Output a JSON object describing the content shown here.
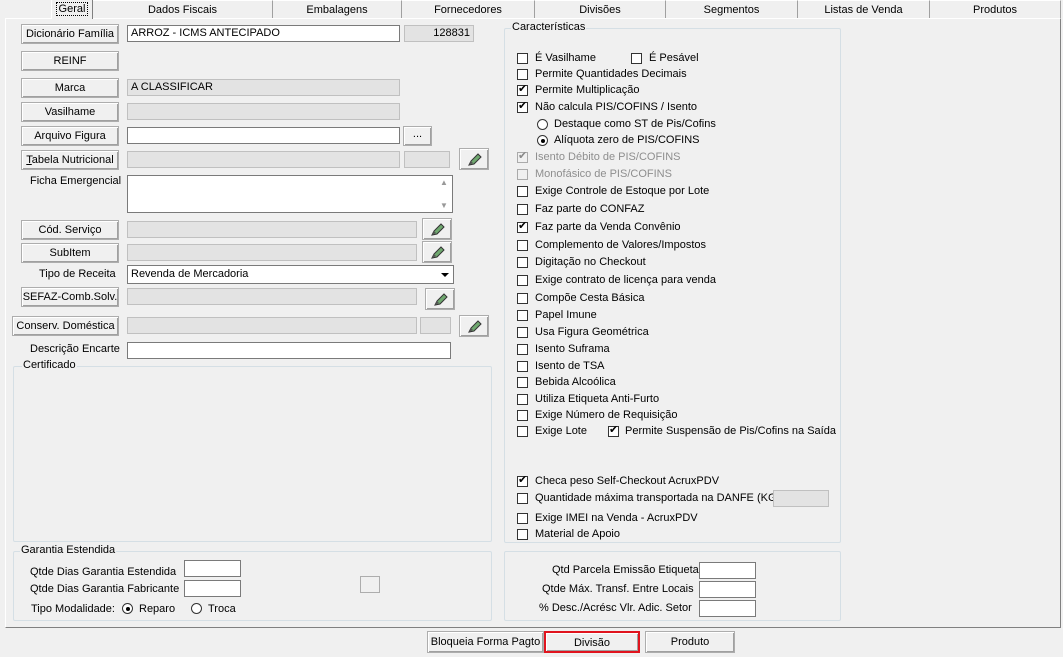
{
  "tabs": [
    "Geral",
    "Dados Fiscais",
    "Embalagens",
    "Fornecedores",
    "Divisões",
    "Segmentos",
    "Listas de Venda",
    "Produtos"
  ],
  "left": {
    "dicionario_label": "Dicionário Família",
    "dicionario_value": "ARROZ - ICMS ANTECIPADO",
    "dicionario_code": "128831",
    "reinf_label": "REINF",
    "marca_label": "Marca",
    "marca_value": "A CLASSIFICAR",
    "vasilhame_label": "Vasilhame",
    "arquivo_label": "Arquivo Figura",
    "browse_label": "...",
    "tabela_label_rest": "abela Nutricional",
    "tabela_label_first": "T",
    "ficha_label": "Ficha Emergencial",
    "cod_servico_label": "Cód. Serviço",
    "subitem_label": "SubItem",
    "tipo_receita_label": "Tipo de Receita",
    "tipo_receita_value": "Revenda de Mercadoria",
    "sefaz_label": "SEFAZ-Comb.Solv.",
    "conserv_label": "Conserv. Doméstica",
    "descricao_label": "Descrição Encarte",
    "certificado_label": "Certificado"
  },
  "caracteristicas": {
    "title": "Características",
    "items": [
      {
        "label": "É Vasilhame",
        "checked": false
      },
      {
        "label": "Permite Quantidades Decimais",
        "checked": false
      },
      {
        "label": "Permite Multiplicação",
        "checked": true
      },
      {
        "label": "Não calcula PIS/COFINS / Isento",
        "checked": true
      },
      {
        "label": "Isento Débito de PIS/COFINS",
        "checked": true,
        "disabled": true
      },
      {
        "label": "Monofásico de PIS/COFINS",
        "checked": false,
        "disabled": true
      },
      {
        "label": "Exige Controle de Estoque por Lote",
        "checked": false
      },
      {
        "label": "Faz parte do CONFAZ",
        "checked": false
      },
      {
        "label": "Faz parte da Venda Convênio",
        "checked": true
      },
      {
        "label": "Complemento de Valores/Impostos",
        "checked": false
      },
      {
        "label": "Digitação no Checkout",
        "checked": false
      },
      {
        "label": "Exige contrato de licença para venda",
        "checked": false
      },
      {
        "label": "Compõe Cesta Básica",
        "checked": false
      },
      {
        "label": "Papel Imune",
        "checked": false
      },
      {
        "label": "Usa Figura Geométrica",
        "checked": false
      },
      {
        "label": "Isento Suframa",
        "checked": false
      },
      {
        "label": "Isento de TSA",
        "checked": false
      },
      {
        "label": "Bebida Alcoólica",
        "checked": false
      },
      {
        "label": "Utiliza Etiqueta Anti-Furto",
        "checked": false
      },
      {
        "label": "Exige Número de Requisição",
        "checked": false
      },
      {
        "label": "Exige Lote",
        "checked": false
      }
    ],
    "pesavel_label": "É Pesável",
    "radio_st_label": "Destaque como ST de Pis/Cofins",
    "radio_zero_label": "Alíquota zero de PIS/COFINS",
    "suspensao_label": "Permite Suspensão de Pis/Cofins na Saída",
    "checa_peso_label": "Checa peso Self-Checkout AcruxPDV",
    "qtd_max_label": "Quantidade máxima transportada na DANFE (KG)",
    "imei_label": "Exige IMEI na Venda - AcruxPDV",
    "material_label": "Material de Apoio"
  },
  "garantia": {
    "title": "Garantia Estendida",
    "qtde_estendida_label": "Qtde Dias Garantia Estendida",
    "qtde_fabricante_label": "Qtde Dias Garantia Fabricante",
    "tipo_label": "Tipo Modalidade:",
    "reparo_label": "Reparo",
    "troca_label": "Troca"
  },
  "etiqueta": {
    "qtd_parcela_label": "Qtd Parcela Emissão Etiqueta",
    "qtde_max_label": "Qtde Máx. Transf. Entre Locais",
    "desc_label": "% Desc./Acrésc Vlr. Adic. Setor"
  },
  "bottom": {
    "bloqueia_label": "Bloqueia Forma Pagto",
    "divisao_label": "Divisão",
    "produto_label": "Produto"
  }
}
